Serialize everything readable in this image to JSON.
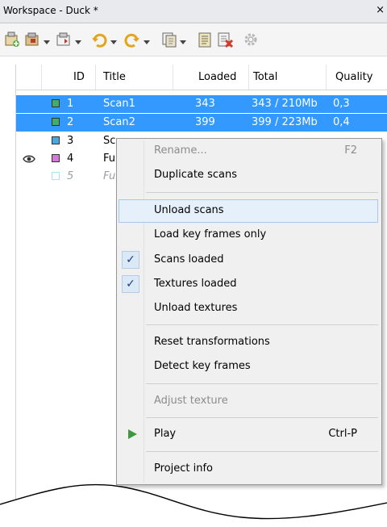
{
  "window": {
    "title": "Workspace - Duck *",
    "close_glyph": "×"
  },
  "toolbar": {
    "icons": [
      "add-scan-icon",
      "import-icon",
      "export-icon",
      "undo-icon",
      "redo-icon",
      "copy-icon",
      "notes-icon",
      "delete-icon",
      "settings-icon"
    ]
  },
  "columns": [
    "ID",
    "Title",
    "Loaded",
    "Total",
    "Quality"
  ],
  "rows": [
    {
      "id": "1",
      "title": "Scan1",
      "loaded": "343",
      "total": "343 / 210Mb",
      "quality": "0,3",
      "color": "#3fae6a",
      "selected": true,
      "eye": false
    },
    {
      "id": "2",
      "title": "Scan2",
      "loaded": "399",
      "total": "399 / 223Mb",
      "quality": "0,4",
      "color": "#3fae6a",
      "selected": true,
      "eye": false
    },
    {
      "id": "3",
      "title": "Sc",
      "loaded": "",
      "total": "",
      "quality": "",
      "color": "#4aa7e6",
      "selected": false,
      "eye": false
    },
    {
      "id": "4",
      "title": "Fu",
      "loaded": "",
      "total": "",
      "quality": "",
      "color": "#d67ad9",
      "selected": false,
      "eye": true
    },
    {
      "id": "5",
      "title": "Fu",
      "loaded": "",
      "total": "",
      "quality": "",
      "color": "#a6e4ef",
      "selected": false,
      "eye": false
    }
  ],
  "menu": {
    "items": [
      {
        "label": "Rename...",
        "shortcut": "F2",
        "disabled": true
      },
      {
        "label": "Duplicate scans",
        "shortcut": ""
      },
      {
        "label": "Unload scans",
        "shortcut": "",
        "highlighted": true
      },
      {
        "label": "Load key frames only",
        "shortcut": ""
      },
      {
        "label": "Scans loaded",
        "shortcut": "",
        "checked": true
      },
      {
        "label": "Textures loaded",
        "shortcut": "",
        "checked": true
      },
      {
        "label": "Unload textures",
        "shortcut": ""
      },
      {
        "label": "Reset transformations",
        "shortcut": ""
      },
      {
        "label": "Detect key frames",
        "shortcut": ""
      },
      {
        "label": "Adjust texture",
        "shortcut": "",
        "disabled": true
      },
      {
        "label": "Play",
        "shortcut": "Ctrl-P",
        "icon": "play-icon"
      },
      {
        "label": "Project info",
        "shortcut": ""
      }
    ],
    "check_glyph": "✓"
  },
  "colors": {
    "selection": "#3399ff",
    "menu_bg": "#f0f0f0",
    "play": "#3c9a3c"
  }
}
